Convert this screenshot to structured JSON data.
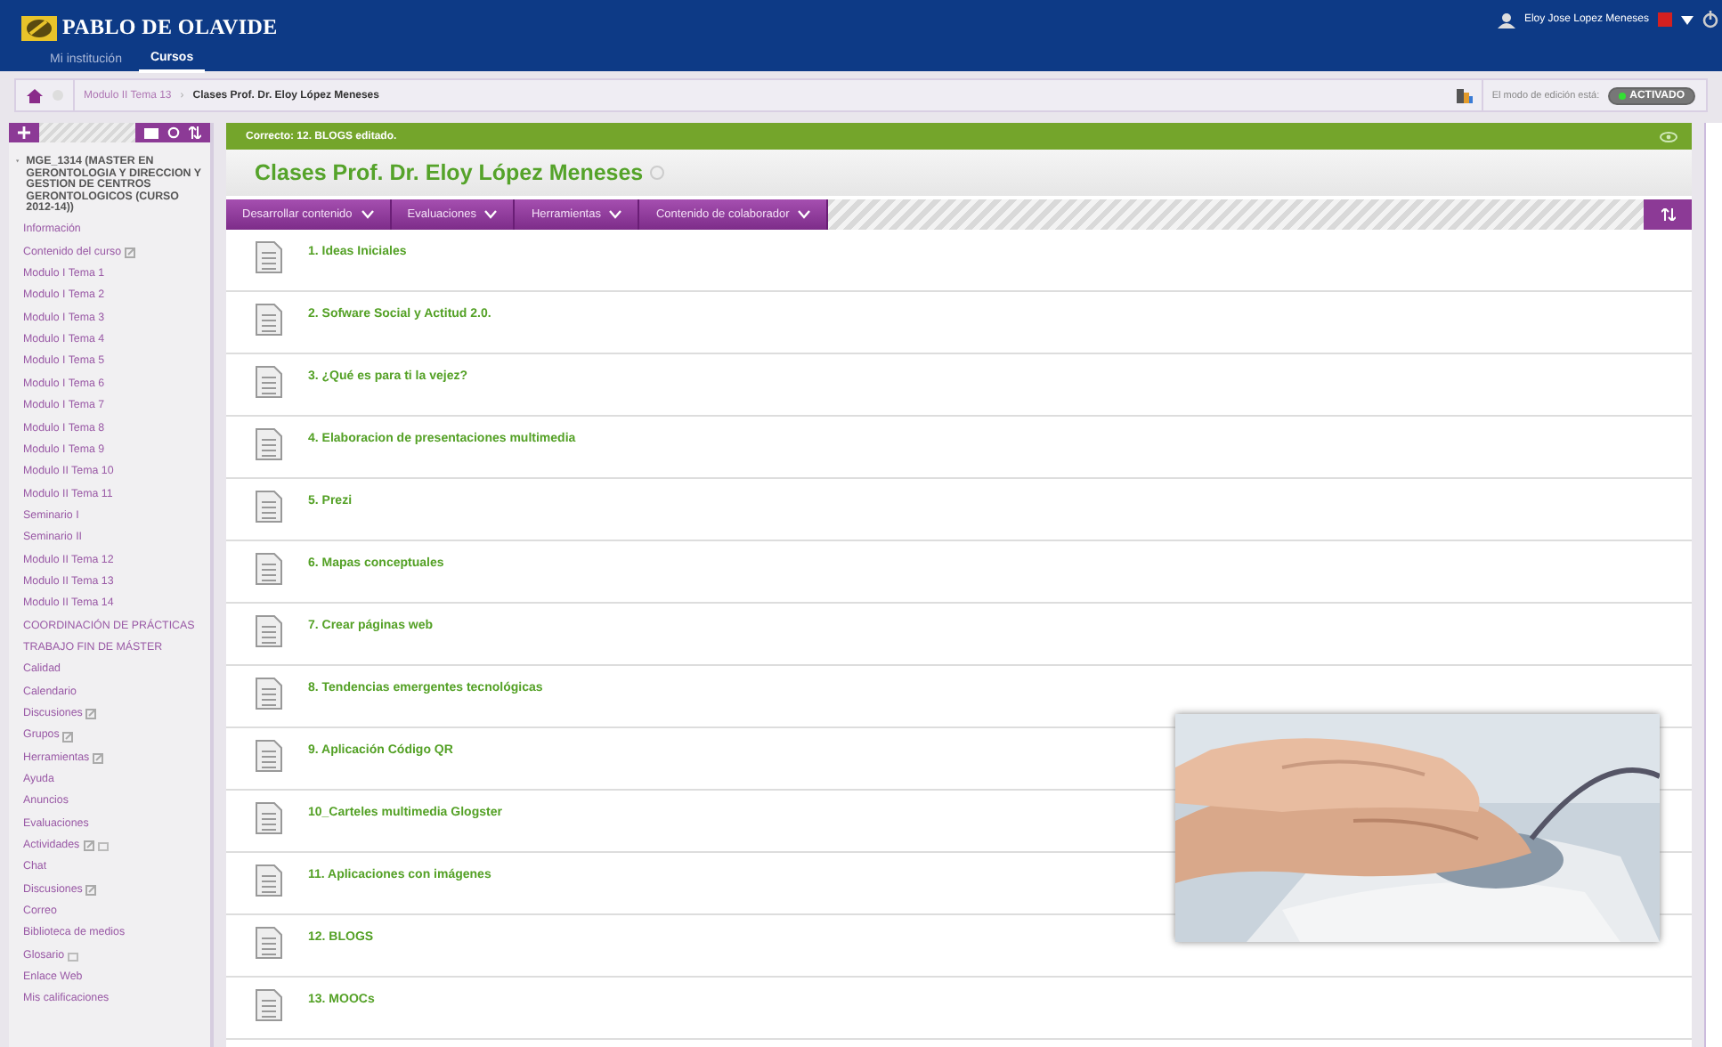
{
  "header": {
    "logo": "PABLO DE OLAVIDE",
    "tabs": [
      {
        "label": "Mi institución",
        "selected": false
      },
      {
        "label": "Cursos",
        "selected": true
      }
    ],
    "user": "Eloy Jose Lopez Meneses"
  },
  "breadcrumb": {
    "separator": "›",
    "items": [
      "Modulo II Tema 13",
      "Clases Prof. Dr. Eloy López Meneses"
    ],
    "edit_mode_label": "El modo de edición está:",
    "edit_mode": {
      "label": "ACTIVADO",
      "on": true
    }
  },
  "sidebar": {
    "course": "MGE_1314 (MASTER EN GERONTOLOGIA Y DIRECCION Y GESTION DE CENTROS GERONTOLOGICOS (CURSO 2012-14))",
    "items": [
      {
        "label": "Información",
        "link_icon": false,
        "box_icon": false
      },
      {
        "label": "Contenido del curso",
        "link_icon": true,
        "box_icon": false
      },
      {
        "label": "Modulo I Tema 1",
        "link_icon": false,
        "box_icon": false
      },
      {
        "label": "Modulo I Tema 2",
        "link_icon": false,
        "box_icon": false
      },
      {
        "label": "Modulo I Tema 3",
        "link_icon": false,
        "box_icon": false
      },
      {
        "label": "Modulo I Tema 4",
        "link_icon": false,
        "box_icon": false
      },
      {
        "label": "Modulo I Tema 5",
        "link_icon": false,
        "box_icon": false
      },
      {
        "label": "Modulo I Tema 6",
        "link_icon": false,
        "box_icon": false
      },
      {
        "label": "Modulo I Tema 7",
        "link_icon": false,
        "box_icon": false
      },
      {
        "label": "Modulo I Tema 8",
        "link_icon": false,
        "box_icon": false
      },
      {
        "label": "Modulo I Tema 9",
        "link_icon": false,
        "box_icon": false
      },
      {
        "label": "Modulo II Tema 10",
        "link_icon": false,
        "box_icon": false
      },
      {
        "label": "Modulo II Tema 11",
        "link_icon": false,
        "box_icon": false
      },
      {
        "label": "Seminario I",
        "link_icon": false,
        "box_icon": false
      },
      {
        "label": "Seminario II",
        "link_icon": false,
        "box_icon": false
      },
      {
        "label": "Modulo II Tema 12",
        "link_icon": false,
        "box_icon": false
      },
      {
        "label": "Modulo II Tema 13",
        "link_icon": false,
        "box_icon": false
      },
      {
        "label": "Modulo II Tema 14",
        "link_icon": false,
        "box_icon": false
      },
      {
        "label": "COORDINACIÓN DE PRÁCTICAS",
        "link_icon": false,
        "box_icon": false
      },
      {
        "label": "TRABAJO FIN DE MÁSTER",
        "link_icon": false,
        "box_icon": false
      },
      {
        "label": "Calidad",
        "link_icon": false,
        "box_icon": false
      },
      {
        "label": "Calendario",
        "link_icon": false,
        "box_icon": false
      },
      {
        "label": "Discusiones",
        "link_icon": true,
        "box_icon": false
      },
      {
        "label": "Grupos",
        "link_icon": true,
        "box_icon": false
      },
      {
        "label": "Herramientas",
        "link_icon": true,
        "box_icon": false
      },
      {
        "label": "Ayuda",
        "link_icon": false,
        "box_icon": false
      },
      {
        "label": "Anuncios",
        "link_icon": false,
        "box_icon": false
      },
      {
        "label": "Evaluaciones",
        "link_icon": false,
        "box_icon": false
      },
      {
        "label": "Actividades",
        "link_icon": true,
        "box_icon": true
      },
      {
        "label": "Chat",
        "link_icon": false,
        "box_icon": false
      },
      {
        "label": "Discusiones",
        "link_icon": true,
        "box_icon": false
      },
      {
        "label": "Correo",
        "link_icon": false,
        "box_icon": false
      },
      {
        "label": "Biblioteca de medios",
        "link_icon": false,
        "box_icon": false
      },
      {
        "label": "Glosario",
        "link_icon": false,
        "box_icon": true
      },
      {
        "label": "Enlace Web",
        "link_icon": false,
        "box_icon": false
      },
      {
        "label": "Mis calificaciones",
        "link_icon": false,
        "box_icon": false
      }
    ]
  },
  "content": {
    "message": "Correcto: 12. BLOGS editado.",
    "title": "Clases Prof. Dr. Eloy López Meneses",
    "menu": [
      "Desarrollar contenido",
      "Evaluaciones",
      "Herramientas",
      "Contenido de colaborador"
    ],
    "items": [
      "1. Ideas Iniciales",
      "2. Sofware Social y Actitud 2.0.",
      "3. ¿Qué es para ti la vejez?",
      "4. Elaboracion de presentaciones multimedia",
      "5. Prezi",
      "6. Mapas conceptuales",
      "7. Crear páginas web",
      "8. Tendencias emergentes tecnológicas",
      "9. Aplicación Código QR",
      "10_Carteles multimedia Glogster",
      "11. Aplicaciones con imágenes",
      "12. BLOGS",
      "13. MOOCs"
    ]
  }
}
